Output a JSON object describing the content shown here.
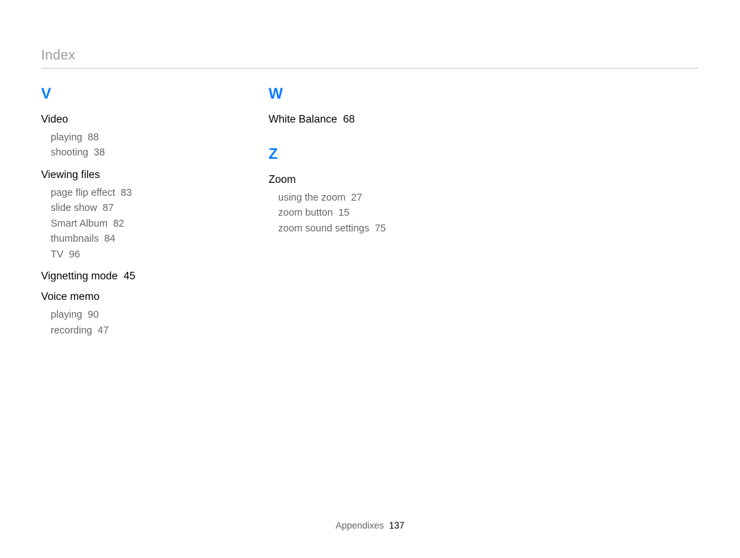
{
  "header": {
    "title": "Index"
  },
  "letters": {
    "v": "V",
    "w": "W",
    "z": "Z"
  },
  "v": {
    "video": {
      "title": "Video",
      "playing": {
        "label": "playing",
        "page": "88"
      },
      "shooting": {
        "label": "shooting",
        "page": "38"
      }
    },
    "viewing_files": {
      "title": "Viewing files",
      "page_flip": {
        "label": "page flip effect",
        "page": "83"
      },
      "slide_show": {
        "label": "slide show",
        "page": "87"
      },
      "smart_album": {
        "label": "Smart Album",
        "page": "82"
      },
      "thumbnails": {
        "label": "thumbnails",
        "page": "84"
      },
      "tv": {
        "label": "TV",
        "page": "96"
      }
    },
    "vignetting": {
      "title": "Vignetting mode",
      "page": "45"
    },
    "voice_memo": {
      "title": "Voice memo",
      "playing": {
        "label": "playing",
        "page": "90"
      },
      "recording": {
        "label": "recording",
        "page": "47"
      }
    }
  },
  "w": {
    "white_balance": {
      "title": "White Balance",
      "page": "68"
    }
  },
  "z": {
    "zoom": {
      "title": "Zoom",
      "using": {
        "label": "using the zoom",
        "page": "27"
      },
      "button": {
        "label": "zoom button",
        "page": "15"
      },
      "sound": {
        "label": "zoom sound settings",
        "page": "75"
      }
    }
  },
  "footer": {
    "label": "Appendixes",
    "page": "137"
  }
}
